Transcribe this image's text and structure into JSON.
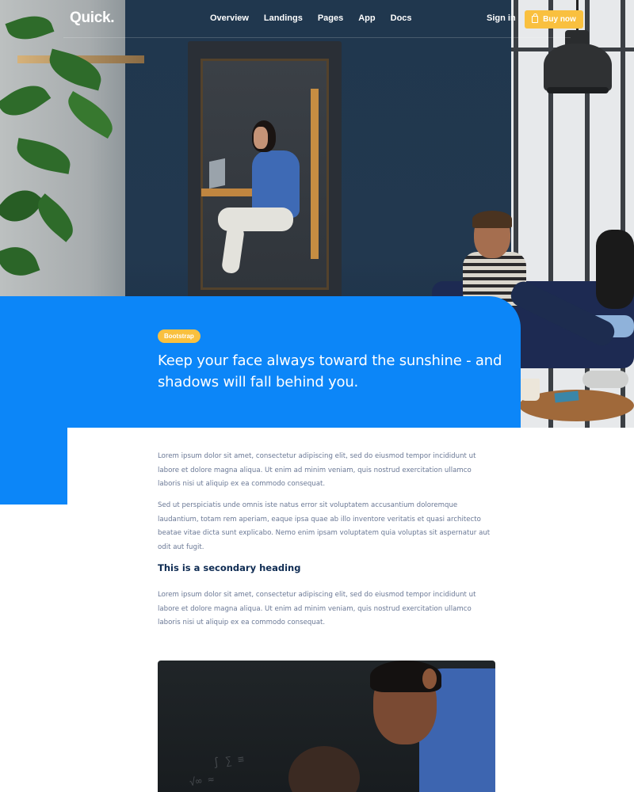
{
  "nav": {
    "logo": "Quick.",
    "links": [
      "Overview",
      "Landings",
      "Pages",
      "App",
      "Docs"
    ],
    "signin": "Sign in",
    "buy": "Buy now"
  },
  "hero": {
    "badge": "Bootstrap",
    "quote": "Keep your face always toward the sunshine - and shadows will fall behind you."
  },
  "content": {
    "p1": "Lorem ipsum dolor sit amet, consectetur adipiscing elit, sed do eiusmod tempor incididunt ut labore et dolore magna aliqua. Ut enim ad minim veniam, quis nostrud exercitation ullamco laboris nisi ut aliquip ex ea commodo consequat.",
    "p2": "Sed ut perspiciatis unde omnis iste natus error sit voluptatem accusantium doloremque laudantium, totam rem aperiam, eaque ipsa quae ab illo inventore veritatis et quasi architecto beatae vitae dicta sunt explicabo. Nemo enim ipsam voluptatem quia voluptas sit aspernatur aut odit aut fugit.",
    "heading": "This is a secondary heading",
    "p3": "Lorem ipsum dolor sit amet, consectetur adipiscing elit, sed do eiusmod tempor incididunt ut labore et dolore magna aliqua. Ut enim ad minim veniam, quis nostrud exercitation ullamco laboris nisi ut aliquip ex ea commodo consequat."
  },
  "colors": {
    "primary": "#0c86f8",
    "accent": "#f9c03f",
    "heading": "#0f2c53",
    "body": "#6a7895"
  }
}
